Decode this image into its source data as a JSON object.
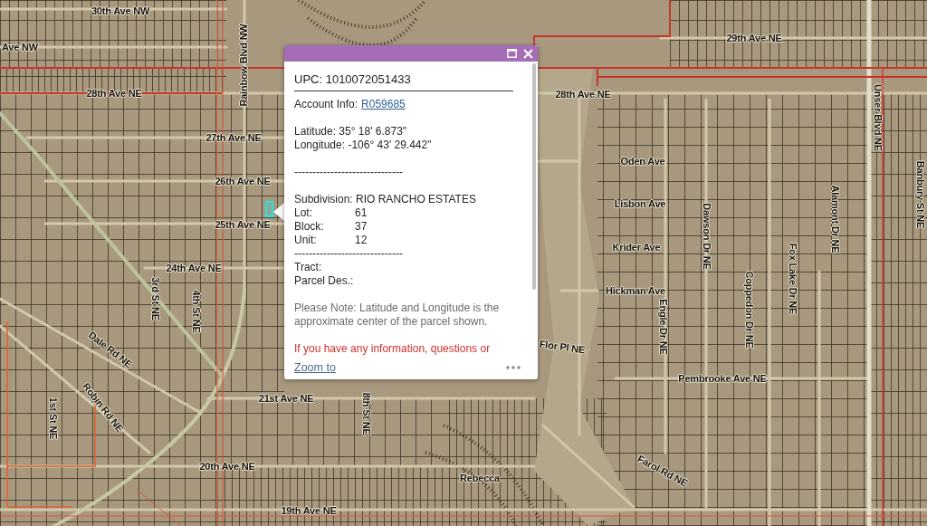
{
  "map": {
    "street_labels": [
      {
        "text": "30th Ave NW"
      },
      {
        "text": "Ave NW"
      },
      {
        "text": "28th Ave NE"
      },
      {
        "text": "27th Ave NE"
      },
      {
        "text": "26th Ave NE"
      },
      {
        "text": "25th Ave NE"
      },
      {
        "text": "24th Ave NE"
      },
      {
        "text": "21st Ave NE"
      },
      {
        "text": "20th Ave NE"
      },
      {
        "text": "19th Ave NE"
      },
      {
        "text": "29th Ave NE"
      },
      {
        "text": "28th Ave NE"
      },
      {
        "text": "Oden Ave"
      },
      {
        "text": "Lisbon Ave"
      },
      {
        "text": "Krider Ave"
      },
      {
        "text": "Hickman Ave"
      },
      {
        "text": "Pembrooke Ave NE"
      },
      {
        "text": "Flor Pl NE"
      },
      {
        "text": "Rebecca"
      },
      {
        "text": "Rainbow Blvd NW"
      },
      {
        "text": "3rd St NE"
      },
      {
        "text": "4th St NE"
      },
      {
        "text": "1st St NE"
      },
      {
        "text": "8th St NE"
      },
      {
        "text": "Dawson Dr NE"
      },
      {
        "text": "Coppedon Dr NE"
      },
      {
        "text": "Engle Dr NE"
      },
      {
        "text": "Fox Lake Dr NE"
      },
      {
        "text": "Alamont Dr NE"
      },
      {
        "text": "Unser Blvd NE"
      },
      {
        "text": "Banbury St NE"
      },
      {
        "text": "Dale Rd NE"
      },
      {
        "text": "Robin Rd NE"
      },
      {
        "text": "Farol Rd NE"
      }
    ]
  },
  "popup": {
    "title": "UPC: 1010072051433",
    "account": {
      "label": "Account Info:",
      "link": "R059685"
    },
    "coordinates": [
      "Latitude: 35° 18' 6.873\"",
      "Longitude: -106° 43' 29.442\""
    ],
    "separator_1": "------------------------------",
    "subdivision": "Subdivision: RIO RANCHO ESTATES",
    "fields": [
      {
        "label": "Lot:",
        "value": "61"
      },
      {
        "label": "Block:",
        "value": "37"
      },
      {
        "label": "Unit:",
        "value": "12"
      }
    ],
    "separator_2": "------------------------------",
    "extra_fields": [
      {
        "label": "Tract:"
      },
      {
        "label": "Parcel Des.:"
      }
    ],
    "note": "Please Note: Latitude and Longitude is the approximate center of the parcel shown.",
    "warning": "If you have any information, questions or",
    "footer": {
      "link": "Zoom to"
    }
  }
}
